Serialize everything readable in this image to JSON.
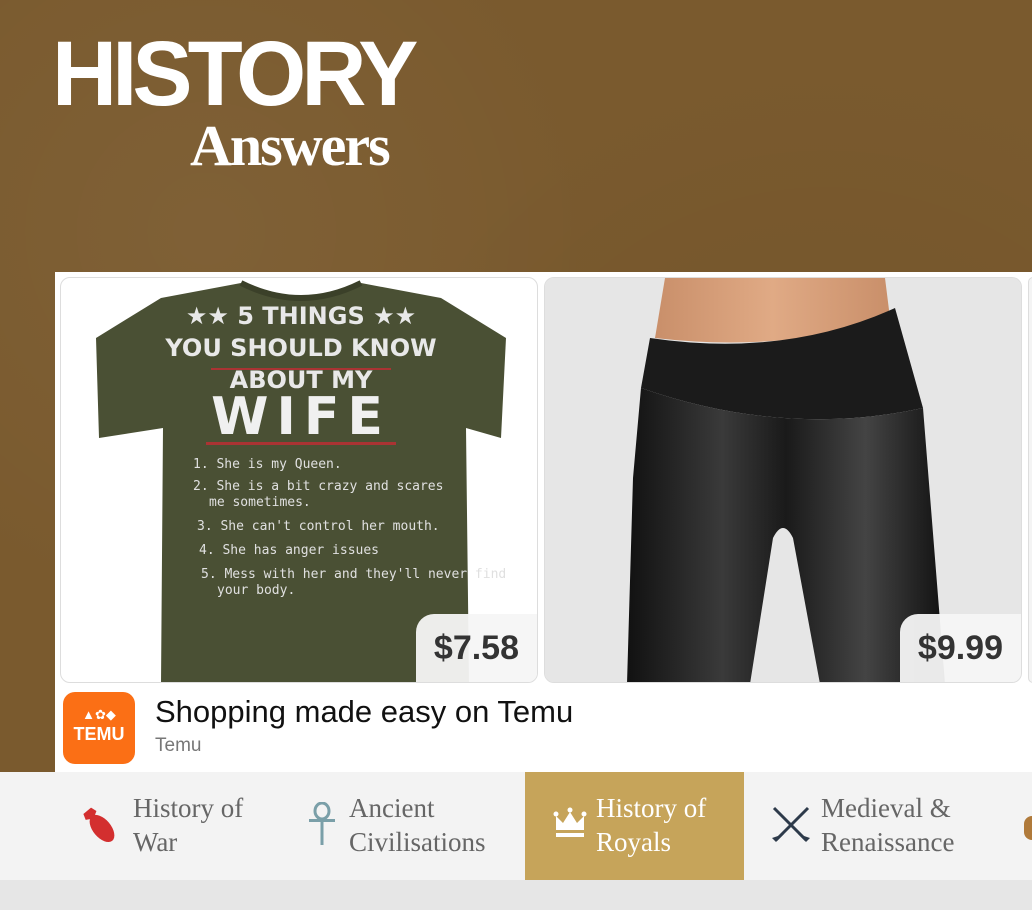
{
  "site": {
    "logo_main": "HISTORY",
    "logo_sub": "Answers"
  },
  "ad": {
    "products": [
      {
        "price": "$7.58",
        "shirt_text": {
          "head1": "★★ 5 THINGS ★★",
          "head2": "YOU SHOULD KNOW",
          "head3": "ABOUT MY",
          "head4": "WIFE",
          "items": [
            "1. She is my Queen.",
            "2. She is a bit crazy and scares",
            "me sometimes.",
            "3. She can't control her mouth.",
            "4. She has anger issues",
            "5. Mess with her and they'll never find",
            "your body."
          ]
        }
      },
      {
        "price": "$9.99"
      }
    ],
    "advertiser_logo_text": "TEMU",
    "title": "Shopping made easy on Temu",
    "advertiser": "Temu"
  },
  "nav": {
    "items": [
      {
        "line1": "History of",
        "line2": "War",
        "icon": "bomb-icon",
        "active": false
      },
      {
        "line1": "Ancient",
        "line2": "Civilisations",
        "icon": "ankh-icon",
        "active": false
      },
      {
        "line1": "History of",
        "line2": "Royals",
        "icon": "crown-icon",
        "active": true
      },
      {
        "line1": "Medieval &",
        "line2": "Renaissance",
        "icon": "crossed-swords-icon",
        "active": false
      }
    ]
  },
  "colors": {
    "header_bg": "#7a5a2e",
    "nav_active_bg": "#c6a45a",
    "temu_orange": "#fb6f15",
    "bomb_red": "#d32f2f",
    "ankh_teal": "#7a9fa8"
  }
}
